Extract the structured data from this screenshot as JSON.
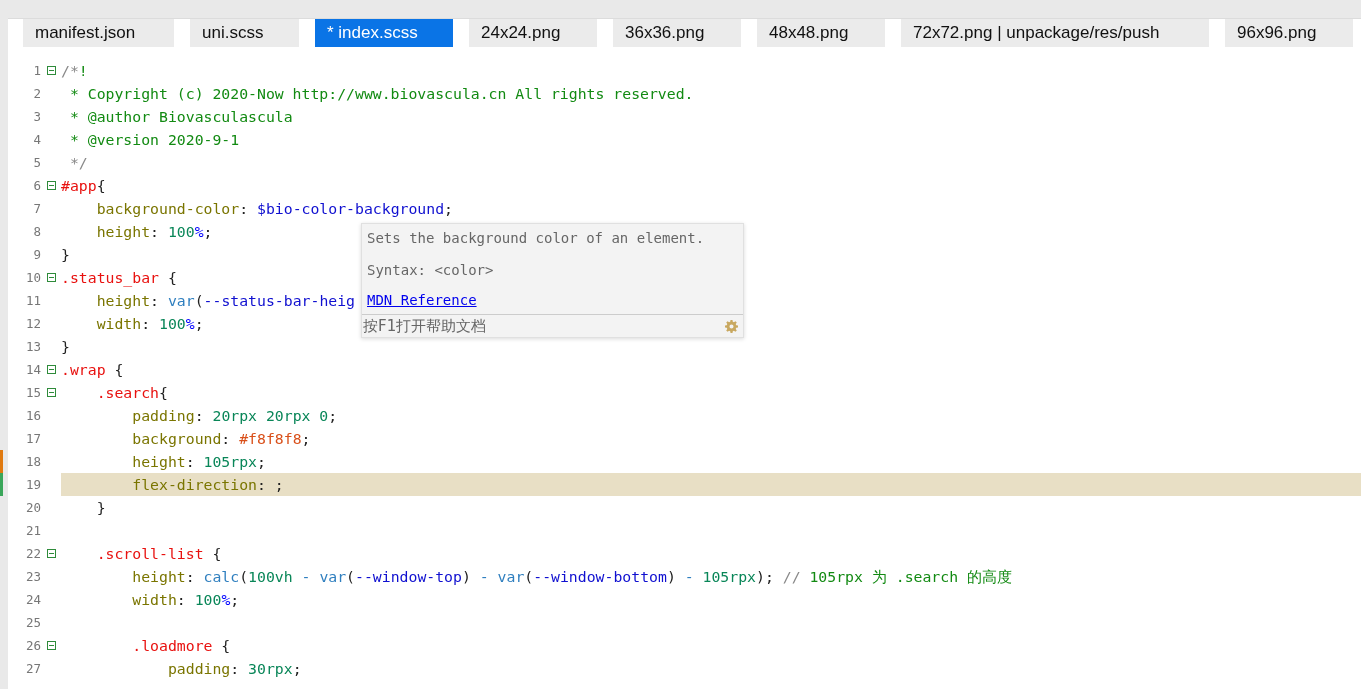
{
  "tabs": [
    {
      "label": "manifest.json",
      "selected": false
    },
    {
      "label": "uni.scss",
      "selected": false
    },
    {
      "label": "* index.scss",
      "selected": true
    },
    {
      "label": "24x24.png",
      "selected": false
    },
    {
      "label": "36x36.png",
      "selected": false
    },
    {
      "label": "48x48.png",
      "selected": false
    },
    {
      "label": "72x72.png | unpackage/res/push",
      "selected": false
    },
    {
      "label": "96x96.png",
      "selected": false
    }
  ],
  "editor": {
    "lines": [
      {
        "number": "1",
        "fold": true,
        "current": false,
        "modified": false,
        "added": false,
        "tokens": [
          {
            "kind": "comment-mark",
            "text": "/*"
          },
          {
            "kind": "comment",
            "text": "!"
          }
        ]
      },
      {
        "number": "2",
        "fold": false,
        "current": false,
        "modified": false,
        "added": false,
        "tokens": [
          {
            "kind": "comment",
            "text": " * Copyright (c) 2020-Now http://www.biovascula.cn All rights reserved."
          }
        ]
      },
      {
        "number": "3",
        "fold": false,
        "current": false,
        "modified": false,
        "added": false,
        "tokens": [
          {
            "kind": "comment",
            "text": " * @author Biovasculascula"
          }
        ]
      },
      {
        "number": "4",
        "fold": false,
        "current": false,
        "modified": false,
        "added": false,
        "tokens": [
          {
            "kind": "comment",
            "text": " * @version 2020-9-1"
          }
        ]
      },
      {
        "number": "5",
        "fold": false,
        "current": false,
        "modified": false,
        "added": false,
        "tokens": [
          {
            "kind": "comment-mark",
            "text": " */"
          }
        ]
      },
      {
        "number": "6",
        "fold": true,
        "current": false,
        "modified": false,
        "added": false,
        "tokens": [
          {
            "kind": "selector",
            "text": "#app"
          },
          {
            "kind": "punct",
            "text": "{"
          }
        ]
      },
      {
        "number": "7",
        "fold": false,
        "current": false,
        "modified": false,
        "added": false,
        "tokens": [
          {
            "kind": "prop",
            "text": "    background-color"
          },
          {
            "kind": "punct",
            "text": ": "
          },
          {
            "kind": "var",
            "text": "$bio-color-background"
          },
          {
            "kind": "punct",
            "text": ";"
          }
        ]
      },
      {
        "number": "8",
        "fold": false,
        "current": false,
        "modified": false,
        "added": false,
        "tokens": [
          {
            "kind": "prop",
            "text": "    height"
          },
          {
            "kind": "punct",
            "text": ": "
          },
          {
            "kind": "num",
            "text": "100"
          },
          {
            "kind": "unit",
            "text": "%"
          },
          {
            "kind": "punct",
            "text": ";"
          }
        ]
      },
      {
        "number": "9",
        "fold": false,
        "current": false,
        "modified": false,
        "added": false,
        "tokens": [
          {
            "kind": "punct",
            "text": "}"
          }
        ]
      },
      {
        "number": "10",
        "fold": true,
        "current": false,
        "modified": false,
        "added": false,
        "tokens": [
          {
            "kind": "selector",
            "text": ".status_bar"
          },
          {
            "kind": "punct",
            "text": " {"
          }
        ]
      },
      {
        "number": "11",
        "fold": false,
        "current": false,
        "modified": false,
        "added": false,
        "tokens": [
          {
            "kind": "prop",
            "text": "    height"
          },
          {
            "kind": "punct",
            "text": ": "
          },
          {
            "kind": "func",
            "text": "var"
          },
          {
            "kind": "punct",
            "text": "("
          },
          {
            "kind": "var",
            "text": "--status-bar-heig"
          }
        ]
      },
      {
        "number": "12",
        "fold": false,
        "current": false,
        "modified": false,
        "added": false,
        "tokens": [
          {
            "kind": "prop",
            "text": "    width"
          },
          {
            "kind": "punct",
            "text": ": "
          },
          {
            "kind": "num",
            "text": "100"
          },
          {
            "kind": "unit",
            "text": "%"
          },
          {
            "kind": "punct",
            "text": ";"
          }
        ]
      },
      {
        "number": "13",
        "fold": false,
        "current": false,
        "modified": false,
        "added": false,
        "tokens": [
          {
            "kind": "punct",
            "text": "}"
          }
        ]
      },
      {
        "number": "14",
        "fold": true,
        "current": false,
        "modified": false,
        "added": false,
        "tokens": [
          {
            "kind": "selector",
            "text": ".wrap"
          },
          {
            "kind": "punct",
            "text": " {"
          }
        ]
      },
      {
        "number": "15",
        "fold": true,
        "current": false,
        "modified": false,
        "added": false,
        "tokens": [
          {
            "kind": "selector",
            "text": "    .search"
          },
          {
            "kind": "punct",
            "text": "{"
          }
        ]
      },
      {
        "number": "16",
        "fold": false,
        "current": false,
        "modified": false,
        "added": false,
        "tokens": [
          {
            "kind": "prop",
            "text": "        padding"
          },
          {
            "kind": "punct",
            "text": ": "
          },
          {
            "kind": "num",
            "text": "20rpx 20rpx 0"
          },
          {
            "kind": "punct",
            "text": ";"
          }
        ]
      },
      {
        "number": "17",
        "fold": false,
        "current": false,
        "modified": false,
        "added": false,
        "tokens": [
          {
            "kind": "prop",
            "text": "        background"
          },
          {
            "kind": "punct",
            "text": ": "
          },
          {
            "kind": "hex",
            "text": "#f8f8f8"
          },
          {
            "kind": "punct",
            "text": ";"
          }
        ]
      },
      {
        "number": "18",
        "fold": false,
        "current": false,
        "modified": true,
        "added": false,
        "tokens": [
          {
            "kind": "prop",
            "text": "        height"
          },
          {
            "kind": "punct",
            "text": ": "
          },
          {
            "kind": "num",
            "text": "105rpx"
          },
          {
            "kind": "punct",
            "text": ";"
          }
        ]
      },
      {
        "number": "19",
        "fold": false,
        "current": true,
        "modified": false,
        "added": true,
        "tokens": [
          {
            "kind": "prop",
            "text": "        flex-direction"
          },
          {
            "kind": "punct",
            "text": ": ;"
          }
        ]
      },
      {
        "number": "20",
        "fold": false,
        "current": false,
        "modified": false,
        "added": false,
        "tokens": [
          {
            "kind": "punct",
            "text": "    }"
          }
        ]
      },
      {
        "number": "21",
        "fold": false,
        "current": false,
        "modified": false,
        "added": false
      },
      {
        "number": "22",
        "fold": true,
        "current": false,
        "modified": false,
        "added": false,
        "tokens": [
          {
            "kind": "selector",
            "text": "    .scroll-list"
          },
          {
            "kind": "punct",
            "text": " {"
          }
        ]
      },
      {
        "number": "23",
        "fold": false,
        "current": false,
        "modified": false,
        "added": false,
        "tokens": [
          {
            "kind": "prop",
            "text": "        height"
          },
          {
            "kind": "punct",
            "text": ": "
          },
          {
            "kind": "func",
            "text": "calc"
          },
          {
            "kind": "punct",
            "text": "("
          },
          {
            "kind": "num",
            "text": "100vh"
          },
          {
            "kind": "func",
            "text": " - var"
          },
          {
            "kind": "punct",
            "text": "("
          },
          {
            "kind": "var",
            "text": "--window-top"
          },
          {
            "kind": "punct",
            "text": ")"
          },
          {
            "kind": "func",
            "text": " - var"
          },
          {
            "kind": "punct",
            "text": "("
          },
          {
            "kind": "var",
            "text": "--window-bottom"
          },
          {
            "kind": "punct",
            "text": ")"
          },
          {
            "kind": "func",
            "text": " - "
          },
          {
            "kind": "num",
            "text": "105rpx"
          },
          {
            "kind": "punct",
            "text": "); "
          },
          {
            "kind": "comment-mark",
            "text": "//"
          },
          {
            "kind": "comment",
            "text": " 105rpx 为 .search 的高度"
          }
        ]
      },
      {
        "number": "24",
        "fold": false,
        "current": false,
        "modified": false,
        "added": false,
        "tokens": [
          {
            "kind": "prop",
            "text": "        width"
          },
          {
            "kind": "punct",
            "text": ": "
          },
          {
            "kind": "num",
            "text": "100"
          },
          {
            "kind": "unit",
            "text": "%"
          },
          {
            "kind": "punct",
            "text": ";"
          }
        ]
      },
      {
        "number": "25",
        "fold": false,
        "current": false,
        "modified": false,
        "added": false
      },
      {
        "number": "26",
        "fold": true,
        "current": false,
        "modified": false,
        "added": false,
        "tokens": [
          {
            "kind": "selector",
            "text": "        .loadmore"
          },
          {
            "kind": "punct",
            "text": " {"
          }
        ]
      },
      {
        "number": "27",
        "fold": false,
        "current": false,
        "modified": false,
        "added": false,
        "tokens": [
          {
            "kind": "prop",
            "text": "            padding"
          },
          {
            "kind": "punct",
            "text": ": "
          },
          {
            "kind": "num",
            "text": "30rpx"
          },
          {
            "kind": "punct",
            "text": ";"
          }
        ]
      }
    ]
  },
  "tooltip": {
    "description": "Sets the background color of an element.",
    "syntax": "Syntax: <color>",
    "link": "MDN Reference",
    "footer": "按F1打开帮助文档"
  }
}
